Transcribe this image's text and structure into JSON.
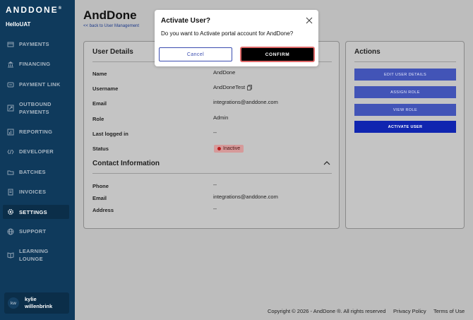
{
  "brand": {
    "logo": "ANDDONE",
    "logo_mark": "®",
    "org": "HelloUAT"
  },
  "sidebar": {
    "items": [
      {
        "label": "PAYMENTS",
        "icon": "payments-icon"
      },
      {
        "label": "FINANCING",
        "icon": "bank-icon"
      },
      {
        "label": "PAYMENT LINK",
        "icon": "link-icon"
      },
      {
        "label_line1": "OUTBOUND",
        "label_line2": "PAYMENTS",
        "icon": "outbound-icon"
      },
      {
        "label": "REPORTING",
        "icon": "report-icon"
      },
      {
        "label": "DEVELOPER",
        "icon": "code-icon"
      },
      {
        "label": "BATCHES",
        "icon": "folder-icon"
      },
      {
        "label": "INVOICES",
        "icon": "invoice-icon"
      },
      {
        "label": "SETTINGS",
        "icon": "gear-icon",
        "active": true
      },
      {
        "label": "SUPPORT",
        "icon": "globe-icon"
      },
      {
        "label_line1": "LEARNING",
        "label_line2": "LOUNGE",
        "icon": "book-icon"
      }
    ],
    "user": {
      "initials": "kw",
      "name_line1": "kylie",
      "name_line2": "willenbrink"
    }
  },
  "page": {
    "title": "AndDone",
    "back_link": "<< back to User Management"
  },
  "user_details": {
    "heading": "User Details",
    "fields": [
      {
        "label": "Name",
        "value": "AndDone"
      },
      {
        "label": "Username",
        "value": "AndDoneTest"
      },
      {
        "label": "Email",
        "value": "integrations@anddone.com"
      },
      {
        "label": "Role",
        "value": "Admin"
      },
      {
        "label": "Last logged in",
        "value": "--"
      },
      {
        "label": "Status",
        "value": "Inactive"
      }
    ]
  },
  "contact": {
    "heading": "Contact Information",
    "fields": [
      {
        "label": "Phone",
        "value": "--"
      },
      {
        "label": "Email",
        "value": "integrations@anddone.com"
      },
      {
        "label": "Address",
        "value": "--"
      }
    ]
  },
  "actions": {
    "heading": "Actions",
    "buttons": [
      "EDIT USER DETAILS",
      "ASSIGN ROLE",
      "VIEW ROLE",
      "ACTIVATE USER"
    ]
  },
  "modal": {
    "title": "Activate User?",
    "message": "Do you want to Activate portal account for AndDone?",
    "cancel": "Cancel",
    "confirm": "CONFIRM"
  },
  "footer": {
    "copyright": "Copyright © 2026 - AndDone ®. All rights reserved",
    "privacy": "Privacy Policy",
    "terms": "Terms of Use"
  },
  "colors": {
    "sidebar": "#0f3a5c",
    "action_button": "#4254b7",
    "primary_button": "#1025b0",
    "badge_inactive": "#d69a9a"
  }
}
